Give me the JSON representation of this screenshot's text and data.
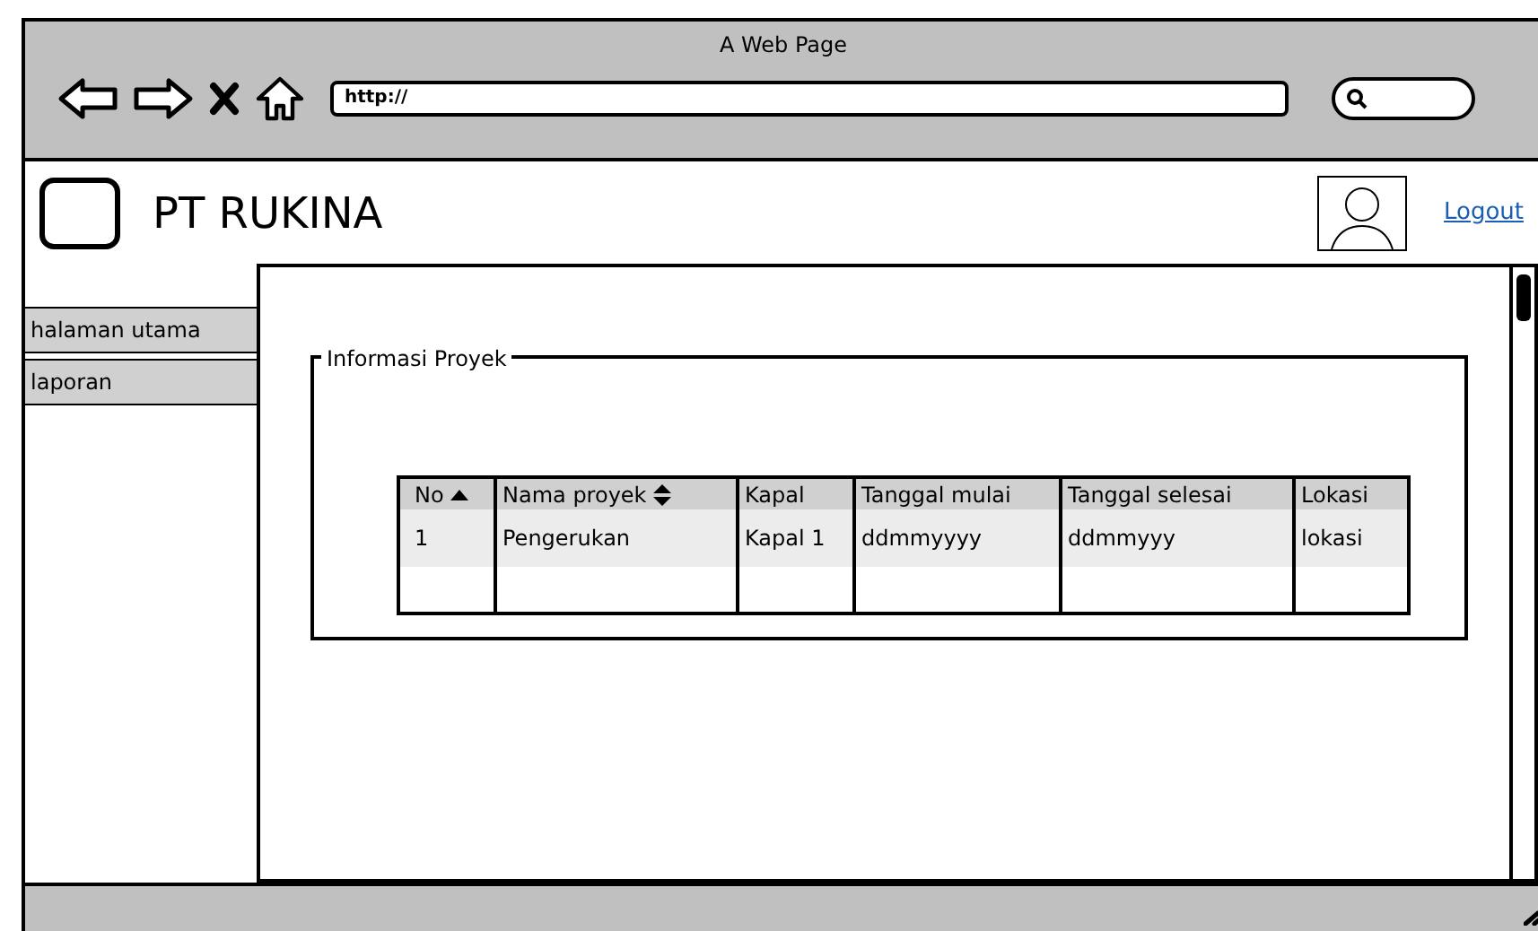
{
  "window": {
    "title": "A Web Page"
  },
  "address_bar": {
    "value": "http://"
  },
  "header": {
    "brand": "PT RUKINA",
    "logout": "Logout"
  },
  "sidebar": {
    "items": [
      {
        "label": "halaman utama"
      },
      {
        "label": "laporan"
      }
    ]
  },
  "panel": {
    "title": "Informasi Proyek",
    "table": {
      "columns": [
        {
          "label": "No",
          "kind": "ascending"
        },
        {
          "label": "Nama proyek",
          "kind": "sortable"
        },
        {
          "label": "Kapal",
          "kind": "plain"
        },
        {
          "label": "Tanggal mulai",
          "kind": "plain"
        },
        {
          "label": "Tanggal selesai",
          "kind": "plain"
        },
        {
          "label": "Lokasi",
          "kind": "plain"
        }
      ],
      "rows": [
        [
          "1",
          "Pengerukan",
          "Kapal 1",
          "ddmmyyyy",
          "ddmmyyy",
          "lokasi"
        ]
      ]
    }
  }
}
